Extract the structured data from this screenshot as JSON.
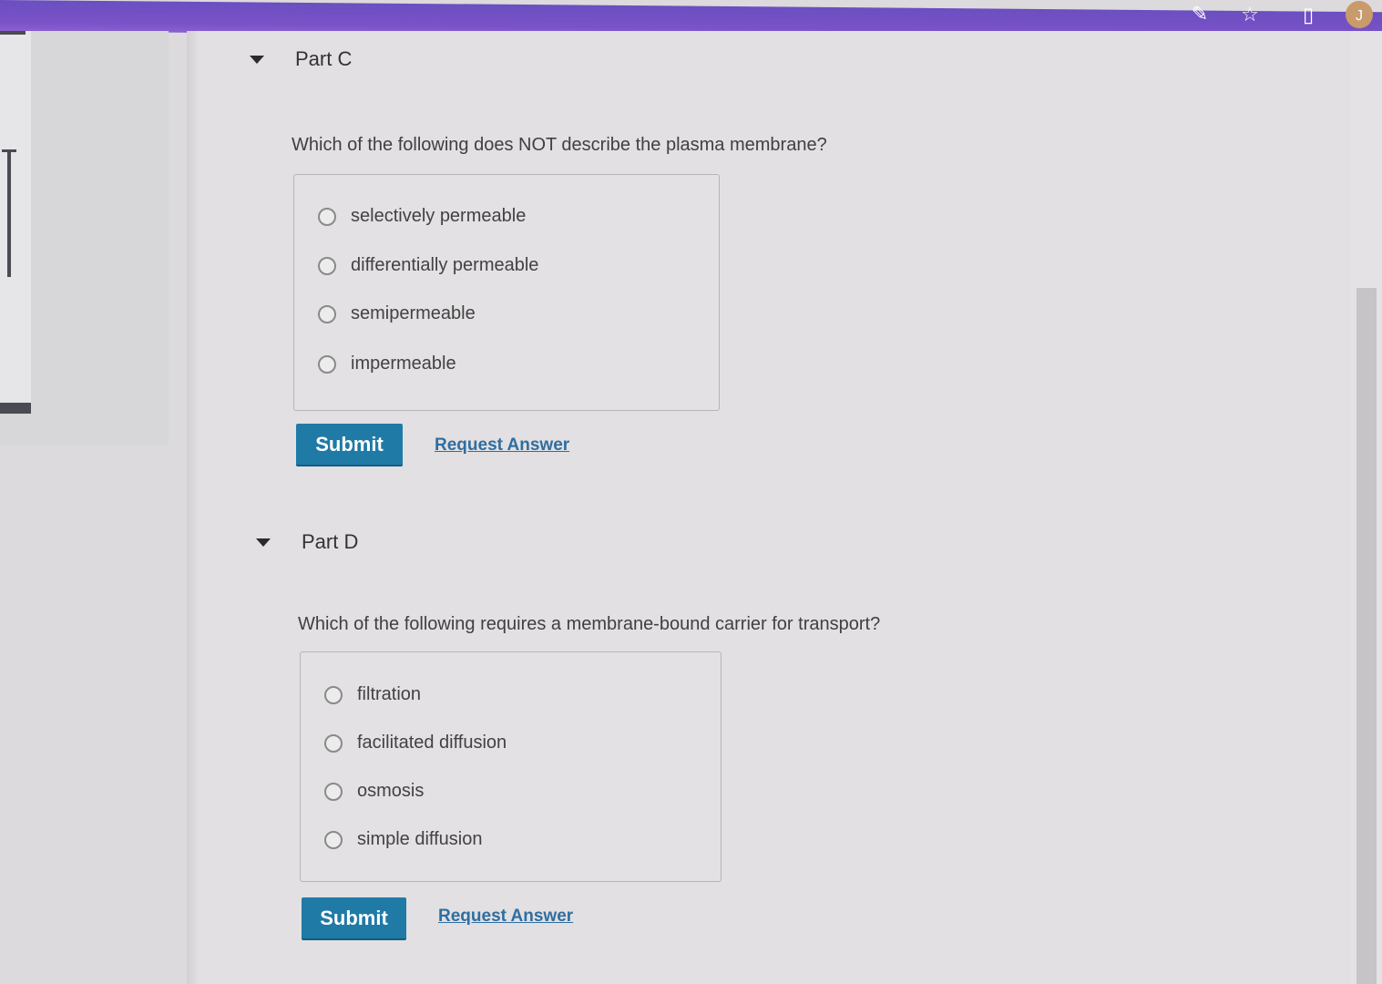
{
  "browser": {
    "icons": [
      "edit-icon",
      "star-icon",
      "panel-icon"
    ],
    "avatar_letter": "J"
  },
  "parts": [
    {
      "title": "Part C",
      "question": "Which of the following does NOT describe the plasma membrane?",
      "options": [
        "selectively permeable",
        "differentially permeable",
        "semipermeable",
        "impermeable"
      ],
      "submit_label": "Submit",
      "request_answer_label": "Request Answer"
    },
    {
      "title": "Part D",
      "question": "Which of the following requires a membrane-bound carrier for transport?",
      "options": [
        "filtration",
        "facilitated diffusion",
        "osmosis",
        "simple diffusion"
      ],
      "submit_label": "Submit",
      "request_answer_label": "Request Answer"
    }
  ],
  "colors": {
    "accent": "#1f7aa6",
    "link": "#2f6ea0",
    "topbar": "#7a52c8"
  }
}
